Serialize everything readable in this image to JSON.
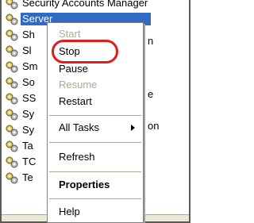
{
  "services": [
    {
      "text": "Security Accounts Manager",
      "selected": false
    },
    {
      "text": "Server",
      "selected": true
    },
    {
      "text": "Sh",
      "selected": false
    },
    {
      "text": "Sl",
      "selected": false
    },
    {
      "text": "Sm",
      "selected": false
    },
    {
      "text": "So",
      "selected": false
    },
    {
      "text": "SS",
      "selected": false
    },
    {
      "text": "Sy",
      "selected": false
    },
    {
      "text": "Sy",
      "selected": false
    },
    {
      "text": "Ta",
      "selected": false
    },
    {
      "text": "TC",
      "selected": false
    },
    {
      "text": "Te",
      "selected": false
    }
  ],
  "right_fragments": {
    "row2": "n",
    "row5": "e",
    "row7": "on"
  },
  "context_menu": {
    "start": "Start",
    "stop": "Stop",
    "pause": "Pause",
    "resume": "Resume",
    "restart": "Restart",
    "all_tasks": "All Tasks",
    "refresh": "Refresh",
    "properties": "Properties",
    "help": "Help"
  },
  "colors": {
    "selection": "#316ac5",
    "highlight_ring": "#e21b1b",
    "disabled_text": "#aca899"
  }
}
